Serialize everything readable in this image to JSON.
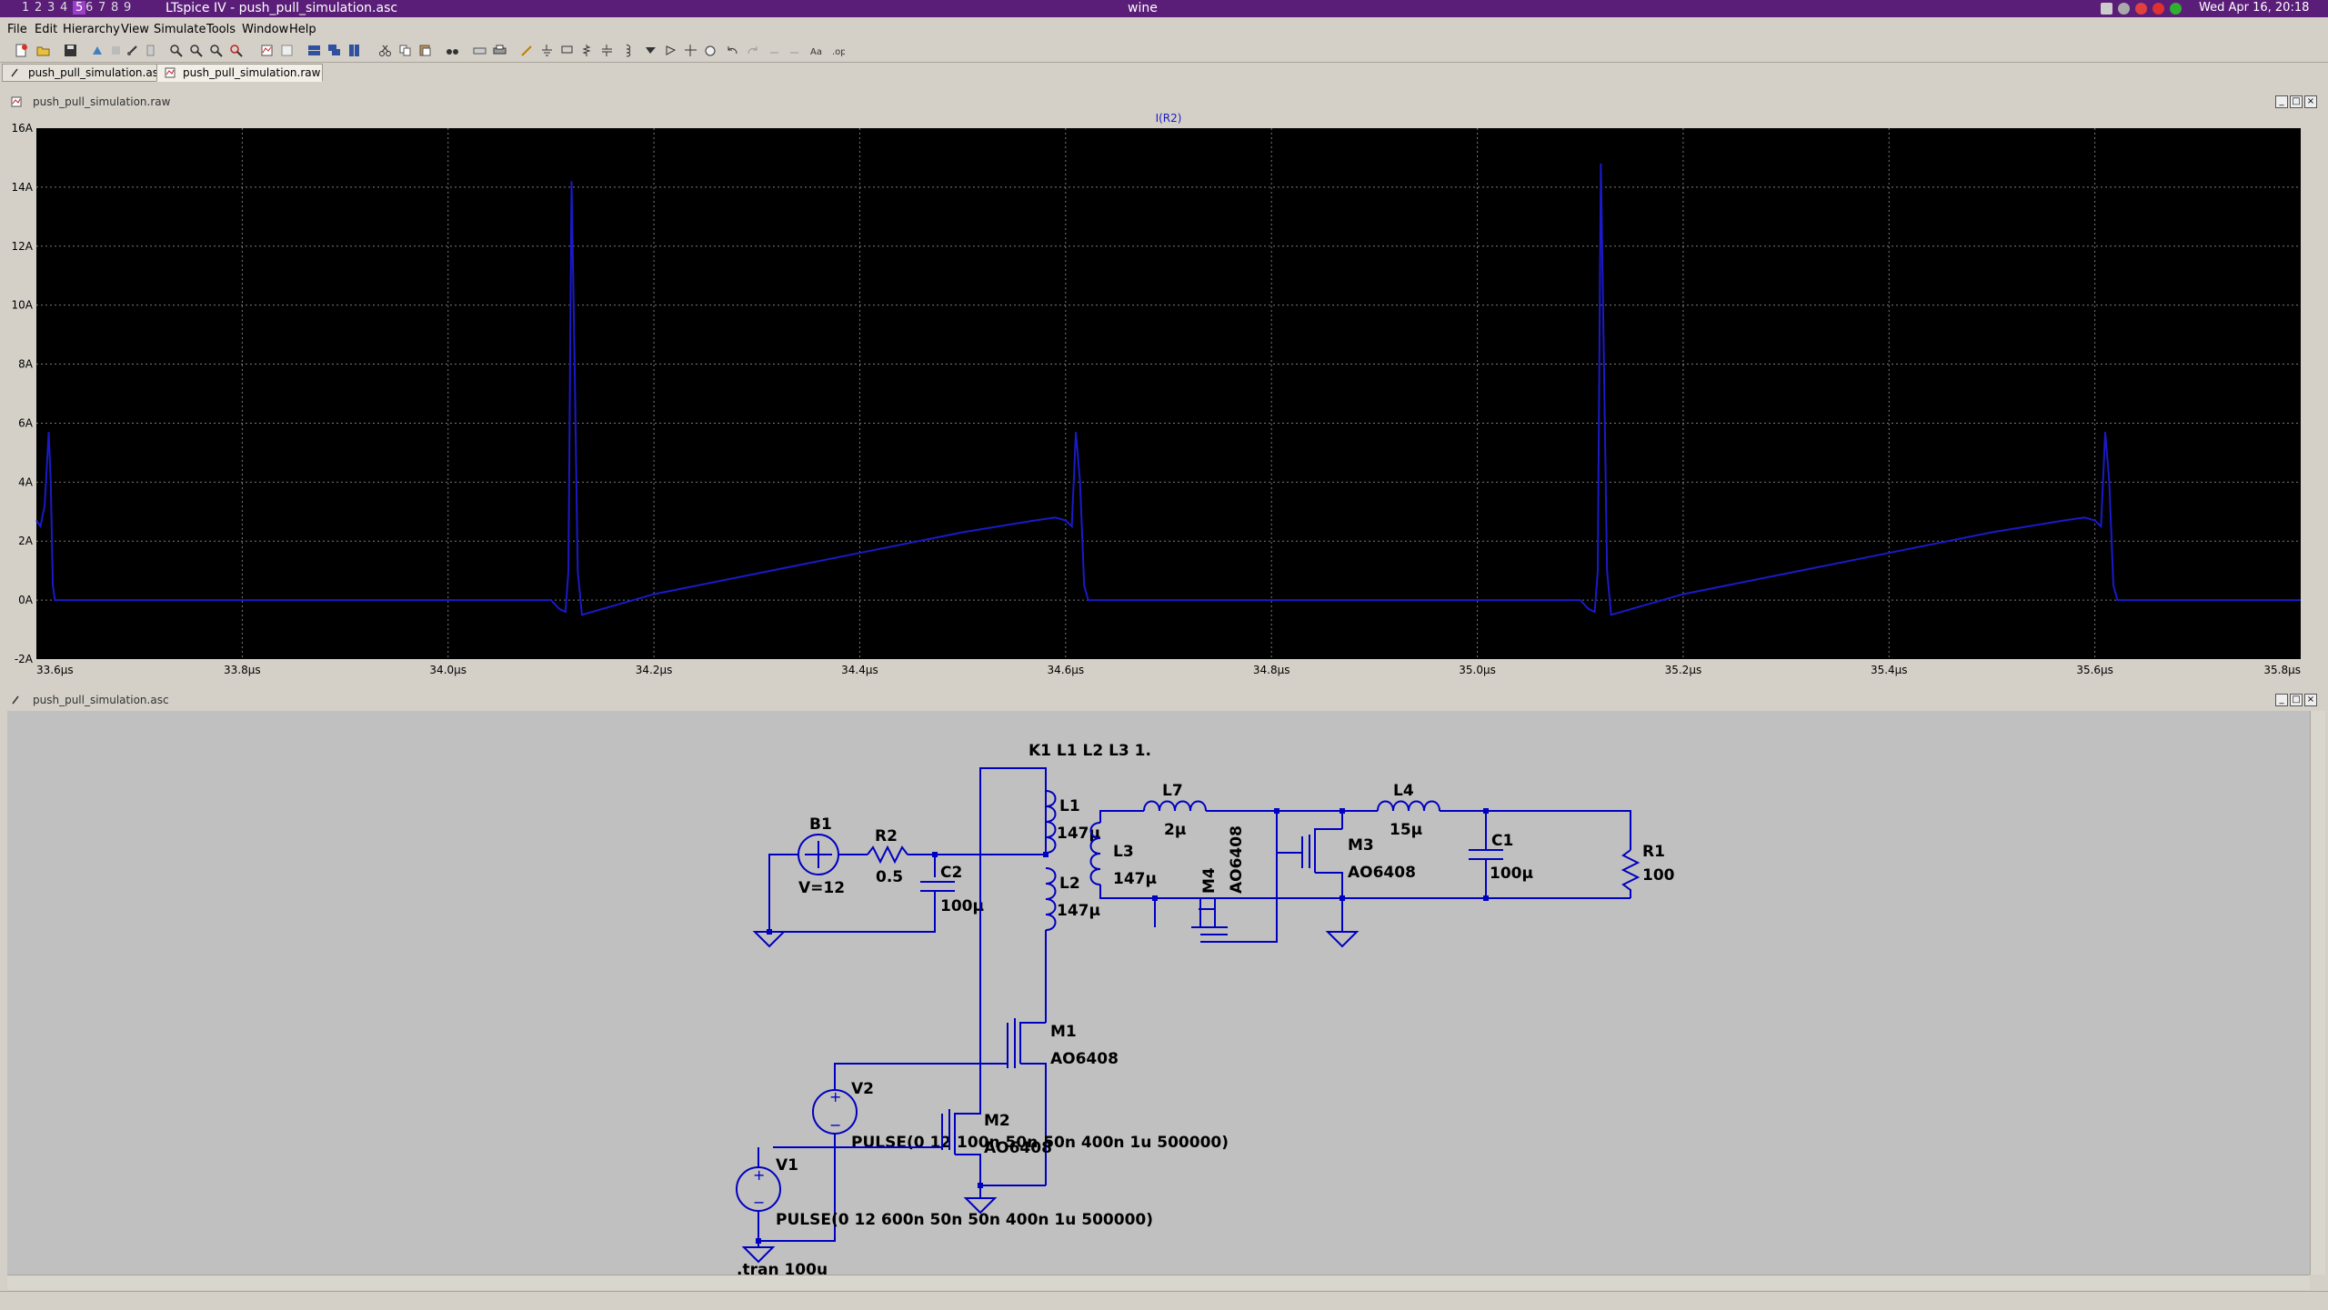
{
  "topbar": {
    "workspaces": [
      "1",
      "2",
      "3",
      "4",
      "5",
      "6",
      "7",
      "8",
      "9"
    ],
    "active_workspace": "5",
    "app_title": "LTspice IV - push_pull_simulation.asc",
    "center_title": "wine",
    "clock": "Wed Apr 16, 20:18"
  },
  "menu": {
    "file": "File",
    "edit": "Edit",
    "hierarchy": "Hierarchy",
    "view": "View",
    "simulate": "Simulate",
    "tools": "Tools",
    "window": "Window",
    "help": "Help"
  },
  "tabs": [
    "push_pull_simulation.asc",
    "push_pull_simulation.raw"
  ],
  "plot_window": {
    "title": "push_pull_simulation.raw",
    "trace_label": "I(R2)",
    "trace_color": "#1a1ac8",
    "background": "#000000",
    "grid_color": "#7a7a7a"
  },
  "chart_data": {
    "type": "line",
    "title": "",
    "xlabel": "",
    "ylabel": "",
    "xlim": [
      33.6,
      35.8
    ],
    "ylim": [
      -2,
      16
    ],
    "x_ticks": [
      "33.6µs",
      "33.8µs",
      "34.0µs",
      "34.2µs",
      "34.4µs",
      "34.6µs",
      "34.8µs",
      "35.0µs",
      "35.2µs",
      "35.4µs",
      "35.6µs",
      "35.8µs"
    ],
    "x_tick_values": [
      33.6,
      33.8,
      34.0,
      34.2,
      34.4,
      34.6,
      34.8,
      35.0,
      35.2,
      35.4,
      35.6,
      35.8
    ],
    "y_ticks": [
      "-2A",
      "0A",
      "2A",
      "4A",
      "6A",
      "8A",
      "10A",
      "12A",
      "14A",
      "16A"
    ],
    "y_tick_values": [
      -2,
      0,
      2,
      4,
      6,
      8,
      10,
      12,
      14,
      16
    ],
    "series": [
      {
        "name": "I(R2)",
        "x": [
          33.6,
          33.604,
          33.608,
          33.612,
          33.614,
          33.616,
          33.618,
          33.62,
          33.622,
          33.624,
          34.1,
          34.108,
          34.114,
          34.117,
          34.12,
          34.123,
          34.126,
          34.13,
          34.14,
          34.16,
          34.2,
          34.3,
          34.4,
          34.5,
          34.57,
          34.59,
          34.6,
          34.606,
          34.61,
          34.614,
          34.618,
          34.622,
          34.63,
          35.1,
          35.108,
          35.114,
          35.117,
          35.12,
          35.123,
          35.126,
          35.13,
          35.14,
          35.16,
          35.2,
          35.3,
          35.4,
          35.5,
          35.57,
          35.59,
          35.6,
          35.606,
          35.61,
          35.614,
          35.618,
          35.622,
          35.63,
          35.8
        ],
        "values": [
          2.7,
          2.5,
          3.2,
          5.7,
          4.0,
          0.5,
          0.0,
          0.0,
          0.0,
          0.0,
          0.0,
          -0.3,
          -0.4,
          1.0,
          14.2,
          8.0,
          1.0,
          -0.5,
          -0.4,
          -0.2,
          0.2,
          0.9,
          1.6,
          2.3,
          2.7,
          2.8,
          2.7,
          2.5,
          5.7,
          4.0,
          0.5,
          0.0,
          0.0,
          0.0,
          -0.3,
          -0.4,
          1.0,
          14.8,
          8.0,
          1.0,
          -0.5,
          -0.4,
          -0.2,
          0.2,
          0.9,
          1.6,
          2.3,
          2.7,
          2.8,
          2.7,
          2.5,
          5.7,
          4.0,
          0.5,
          0.0,
          0.0,
          0.0
        ]
      }
    ],
    "grid": true,
    "legend": "top-center"
  },
  "schematic_window": {
    "title": "push_pull_simulation.asc",
    "wire_color": "#0000c0",
    "labels": {
      "k_directive": "K1 L1 L2 L3 1.",
      "b1": "B1",
      "b1_val": "V=12",
      "r2": "R2",
      "r2_val": "0.5",
      "c2": "C2",
      "c2_val": "100µ",
      "l1": "L1",
      "l1_val": "147µ",
      "l2": "L2",
      "l2_val": "147µ",
      "l3": "L3",
      "l3_val": "147µ",
      "l7": "L7",
      "l7_val": "2µ",
      "m4": "M4",
      "m4_val": "AO6408",
      "m3": "M3",
      "m3_val": "AO6408",
      "l4": "L4",
      "l4_val": "15µ",
      "c1": "C1",
      "c1_val": "100µ",
      "r1": "R1",
      "r1_val": "100",
      "m1": "M1",
      "m1_val": "AO6408",
      "v2": "V2",
      "v2_val": "PULSE(0 12 100n 50n 50n 400n 1u 500000)",
      "m2": "M2",
      "m2_val": "AO6408",
      "v1": "V1",
      "v1_val": "PULSE(0 12 600n 50n 50n 400n 1u 500000)",
      "tran": ".tran 100u"
    }
  }
}
